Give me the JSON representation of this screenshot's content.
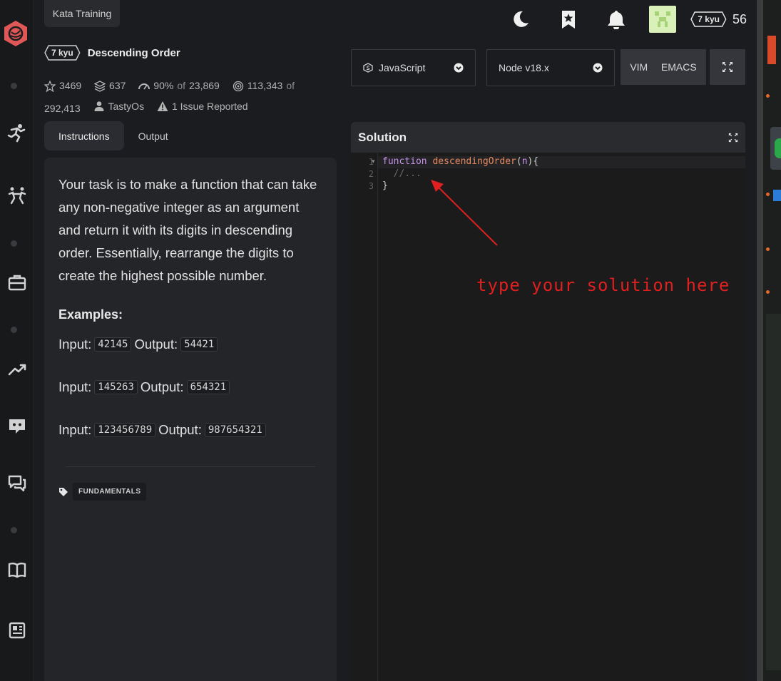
{
  "header": {
    "breadcrumb": "Kata Training",
    "kata_rank": "7 kyu",
    "kata_title": "Descending Order",
    "user_rank": "7 kyu",
    "user_honor": "56"
  },
  "stats": {
    "stars": "3469",
    "collections": "637",
    "satisfaction": "90%",
    "satisfaction_of": "of",
    "satisfaction_votes": "23,869",
    "completed": "113,343",
    "completed_of": "of",
    "attempts": "292,413",
    "author": "TastyOs",
    "issues": "1 Issue Reported"
  },
  "tabs": [
    "Instructions",
    "Output"
  ],
  "instructions": {
    "description": "Your task is to make a function that can take any non-negative integer as an argument and return it with its digits in descending order. Essentially, rearrange the digits to create the highest possible number.",
    "examples_title": "Examples:",
    "input_label": "Input:",
    "output_label": "Output:",
    "examples": [
      {
        "input": "42145",
        "output": "54421"
      },
      {
        "input": "145263",
        "output": "654321"
      },
      {
        "input": "123456789",
        "output": "987654321"
      }
    ],
    "tag": "FUNDAMENTALS"
  },
  "toolbar": {
    "language": "JavaScript",
    "runtime": "Node v18.x",
    "vim": "VIM",
    "emacs": "EMACS"
  },
  "editor": {
    "title": "Solution",
    "line_numbers": [
      "1",
      "2",
      "3"
    ],
    "kw": "function",
    "fn_name": "descendingOrder",
    "open": "(",
    "param": "n",
    "close": "){",
    "line2": "  //...",
    "line3": "}"
  },
  "annotation": "type your solution here",
  "colors": {
    "accent": "#e05757",
    "annotation": "#e02020"
  }
}
